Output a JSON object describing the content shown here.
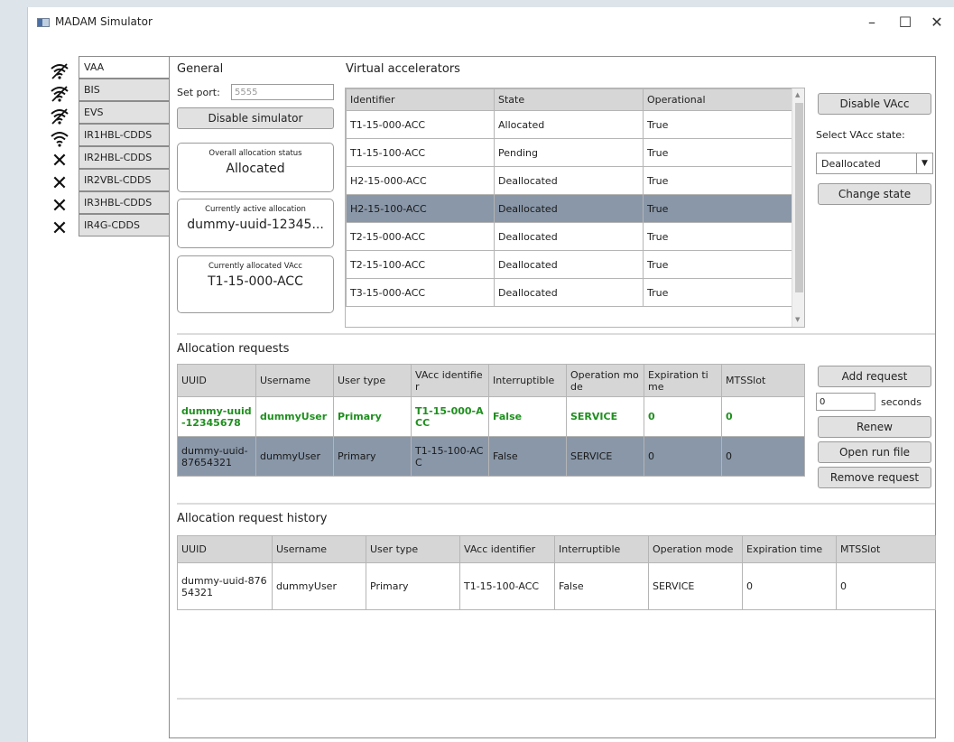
{
  "window": {
    "title": "MADAM Simulator",
    "minimize": "–",
    "maximize": "☐",
    "close": "✕"
  },
  "status_icons": [
    "wifi-off-icon",
    "wifi-off-icon",
    "wifi-off-icon",
    "wifi-icon",
    "x-icon",
    "x-icon",
    "x-icon",
    "x-icon"
  ],
  "tabs": [
    "VAA",
    "BIS",
    "EVS",
    "IR1HBL-CDDS",
    "IR2HBL-CDDS",
    "IR2VBL-CDDS",
    "IR3HBL-CDDS",
    "IR4G-CDDS"
  ],
  "general": {
    "heading": "General",
    "port_label": "Set port:",
    "port_value": "5555",
    "disable_simulator": "Disable simulator",
    "overall_label": "Overall allocation status",
    "overall_value": "Allocated",
    "active_label": "Currently active allocation",
    "active_value": "dummy-uuid-12345...",
    "vacc_label": "Currently allocated VAcc",
    "vacc_value": "T1-15-000-ACC"
  },
  "virtual_accelerators": {
    "heading": "Virtual accelerators",
    "columns": [
      "Identifier",
      "State",
      "Operational"
    ],
    "rows": [
      [
        "T1-15-000-ACC",
        "Allocated",
        "True"
      ],
      [
        "T1-15-100-ACC",
        "Pending",
        "True"
      ],
      [
        "H2-15-000-ACC",
        "Deallocated",
        "True"
      ],
      [
        "H2-15-100-ACC",
        "Deallocated",
        "True"
      ],
      [
        "T2-15-000-ACC",
        "Deallocated",
        "True"
      ],
      [
        "T2-15-100-ACC",
        "Deallocated",
        "True"
      ],
      [
        "T3-15-000-ACC",
        "Deallocated",
        "True"
      ]
    ],
    "selected_row": 3
  },
  "vacc_controls": {
    "disable_vacc": "Disable VAcc",
    "select_label": "Select VAcc state:",
    "select_value": "Deallocated",
    "change_state": "Change state"
  },
  "allocation_requests": {
    "heading": "Allocation requests",
    "columns": [
      "UUID",
      "Username",
      "User type",
      "VAcc identifier",
      "Interruptible",
      "Operation mode",
      "Expiration time",
      "MTSSlot"
    ],
    "rows": [
      [
        "dummy-uuid-12345678",
        "dummyUser",
        "Primary",
        "T1-15-000-ACC",
        "False",
        "SERVICE",
        "0",
        "0"
      ],
      [
        "dummy-uuid-87654321",
        "dummyUser",
        "Primary",
        "T1-15-100-ACC",
        "False",
        "SERVICE",
        "0",
        "0"
      ]
    ],
    "active_row": 0,
    "selected_row": 1
  },
  "request_controls": {
    "add_request": "Add request",
    "seconds_value": "0",
    "seconds_label": "seconds",
    "renew": "Renew",
    "open_run_file": "Open run file",
    "remove_request": "Remove request"
  },
  "history": {
    "heading": "Allocation request history",
    "columns": [
      "UUID",
      "Username",
      "User type",
      "VAcc identifier",
      "Interruptible",
      "Operation mode",
      "Expiration time",
      "MTSSlot"
    ],
    "rows": [
      [
        "dummy-uuid-87654321",
        "dummyUser",
        "Primary",
        "T1-15-100-ACC",
        "False",
        "SERVICE",
        "0",
        "0"
      ]
    ]
  },
  "colors": {
    "selected_row": "#8997a8",
    "active_text": "#1f8f1f",
    "header_bg": "#d6d6d6"
  }
}
